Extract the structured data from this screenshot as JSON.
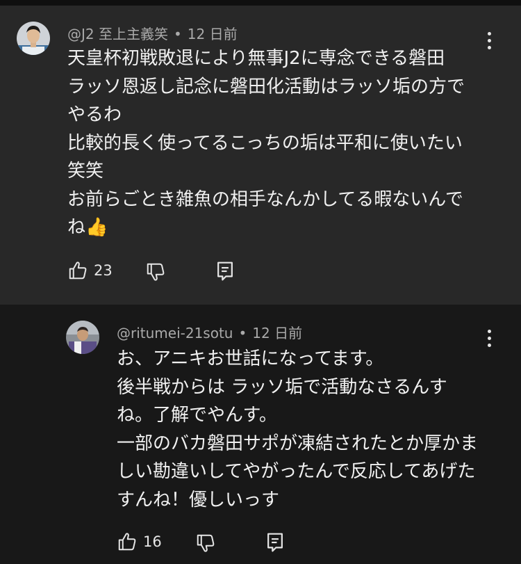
{
  "comment": {
    "author": "@J2 至上主義笑",
    "separator": "•",
    "time": "12 日前",
    "lines": [
      "天皇杯初戦敗退により無事J2に専念できる磐田",
      "ラッソ恩返し記念に磐田化活動はラッソ垢の方で",
      "やるわ",
      "比較的長く使ってるこっちの垢は平和に使いたい",
      "笑笑",
      "お前らごとき雑魚の相手なんかしてる暇ないんで",
      "ね👍"
    ],
    "like_count": "23",
    "icons": {
      "like": "thumbs-up-icon",
      "dislike": "thumbs-down-icon",
      "reply": "reply-comment-icon",
      "menu": "more-vert-icon"
    }
  },
  "reply": {
    "author": "@ritumei-21sotu",
    "separator": "•",
    "time": "12 日前",
    "lines": [
      "お、アニキお世話になってます。",
      "後半戦からは ラッソ垢で活動なさるんす",
      "ね。了解でやんす。",
      "一部のバカ磐田サポが凍結されたとか厚かま",
      "しい勘違いしてやがったんで反応してあげた",
      "すんね！優しいっす"
    ],
    "like_count": "16",
    "icons": {
      "like": "thumbs-up-icon",
      "dislike": "thumbs-down-icon",
      "reply": "reply-comment-icon",
      "menu": "more-vert-icon"
    }
  },
  "colors": {
    "main_bg": "#282828",
    "reply_bg": "#181818",
    "text": "#f1f1f1",
    "meta_text": "#aaaaaa"
  }
}
